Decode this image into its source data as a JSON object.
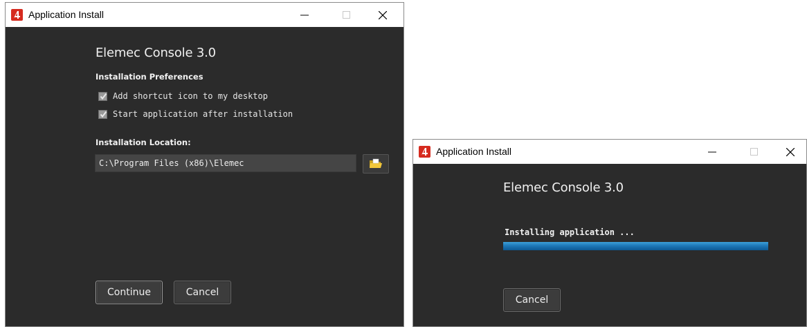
{
  "install_window": {
    "title": "Application Install",
    "app_name": "Elemec Console 3.0",
    "preferences_heading": "Installation Preferences",
    "options": [
      {
        "label": "Add shortcut icon to my desktop",
        "checked": true
      },
      {
        "label": "Start application after installation",
        "checked": true
      }
    ],
    "location_heading": "Installation Location:",
    "location_value": "C:\\Program Files (x86)\\Elemec",
    "browse_icon": "folder-open-icon",
    "continue_label": "Continue",
    "cancel_label": "Cancel"
  },
  "progress_window": {
    "title": "Application Install",
    "app_name": "Elemec Console 3.0",
    "status_text": "Installing application ...",
    "progress_fraction": 1.0,
    "cancel_label": "Cancel"
  },
  "colors": {
    "window_bg": "#2b2b2b",
    "titlebar_bg": "#ffffff",
    "logo_red": "#d62b1f",
    "progress_blue": "#1e78b8"
  }
}
